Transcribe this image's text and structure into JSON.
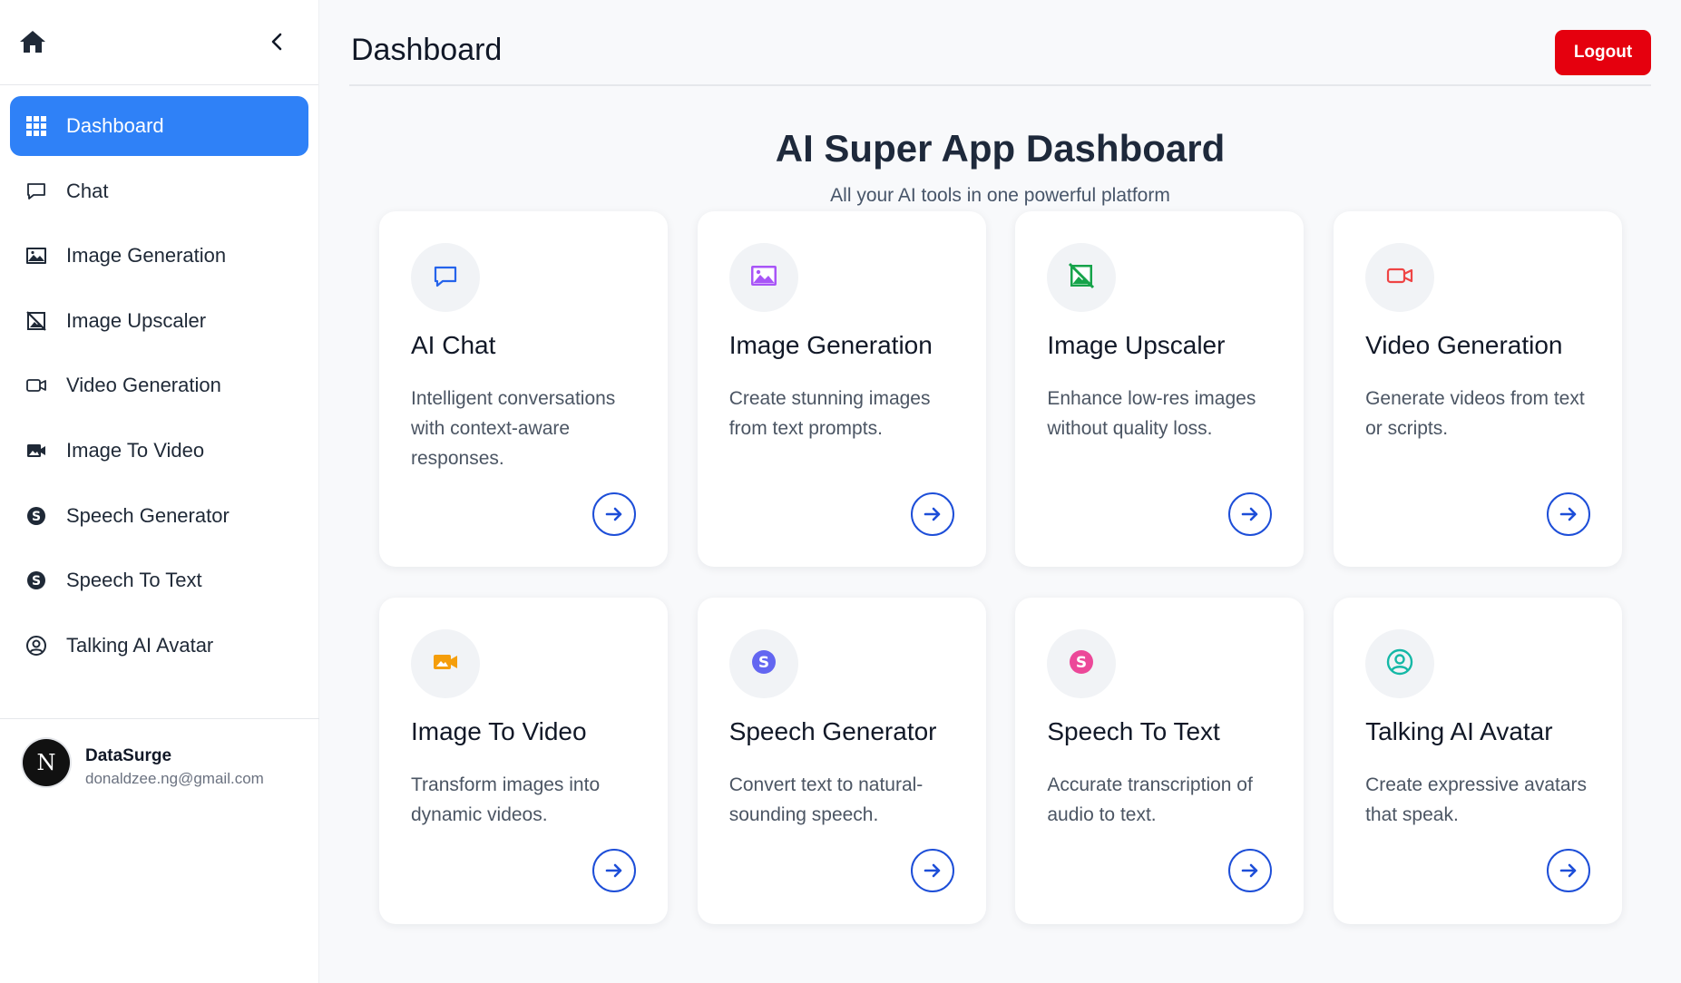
{
  "sidebar": {
    "items": [
      {
        "label": "Dashboard",
        "icon": "grid-icon",
        "active": true
      },
      {
        "label": "Chat",
        "icon": "chat-bubble-icon"
      },
      {
        "label": "Image Generation",
        "icon": "image-icon"
      },
      {
        "label": "Image Upscaler",
        "icon": "image-off-icon"
      },
      {
        "label": "Video Generation",
        "icon": "video-camera-icon"
      },
      {
        "label": "Image To Video",
        "icon": "video-camera-filled-icon"
      },
      {
        "label": "Speech Generator",
        "icon": "speech-s-icon"
      },
      {
        "label": "Speech To Text",
        "icon": "speech-s-icon"
      },
      {
        "label": "Talking AI Avatar",
        "icon": "user-circle-icon"
      }
    ],
    "user": {
      "initial": "N",
      "name": "DataSurge",
      "email": "donaldzee.ng@gmail.com"
    }
  },
  "header": {
    "title": "Dashboard",
    "logout_label": "Logout"
  },
  "hero": {
    "title": "AI Super App Dashboard",
    "subtitle": "All your AI tools in one powerful platform"
  },
  "cards": [
    {
      "title": "AI Chat",
      "description": "Intelligent conversations with context-aware responses.",
      "icon": "chat-bubble-icon",
      "color": "#2563eb"
    },
    {
      "title": "Image Generation",
      "description": "Create stunning images from text prompts.",
      "icon": "image-icon",
      "color": "#a855f7"
    },
    {
      "title": "Image Upscaler",
      "description": "Enhance low-res images without quality loss.",
      "icon": "image-off-icon",
      "color": "#16a34a"
    },
    {
      "title": "Video Generation",
      "description": "Generate videos from text or scripts.",
      "icon": "video-camera-icon",
      "color": "#ef4444"
    },
    {
      "title": "Image To Video",
      "description": "Transform images into dynamic videos.",
      "icon": "video-camera-filled-icon",
      "color": "#f59e0b"
    },
    {
      "title": "Speech Generator",
      "description": "Convert text to natural-sounding speech.",
      "icon": "speech-s-icon",
      "color": "#6366f1"
    },
    {
      "title": "Speech To Text",
      "description": "Accurate transcription of audio to text.",
      "icon": "speech-s-icon",
      "color": "#ec4899"
    },
    {
      "title": "Talking AI Avatar",
      "description": "Create expressive avatars that speak.",
      "icon": "user-circle-icon",
      "color": "#14b8a6"
    }
  ],
  "colors": {
    "accent": "#2f81f7",
    "logout": "#e5000e",
    "arrow": "#1d4ed8"
  }
}
